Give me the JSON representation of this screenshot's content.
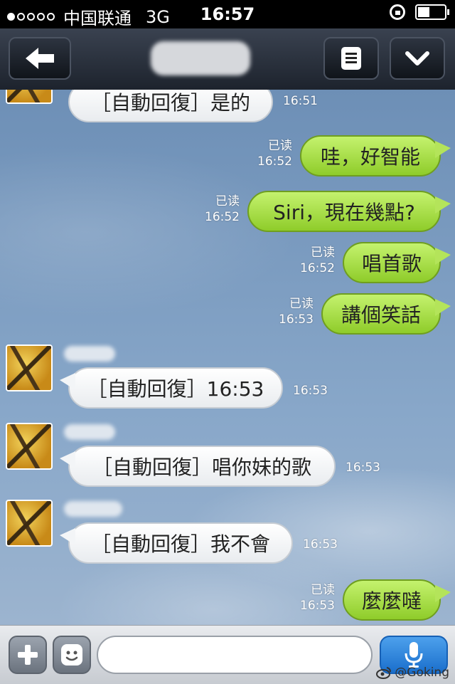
{
  "status_bar": {
    "carrier": "中国联通",
    "network": "3G",
    "time": "16:57",
    "signal_bars_on": 1,
    "signal_bars_total": 5,
    "battery_level": 0.45
  },
  "nav": {
    "back_icon": "arrow-left-icon",
    "menu_icon": "list-icon",
    "dropdown_icon": "chevron-down-icon"
  },
  "messages": [
    {
      "dir": "in",
      "text": "［自動回復］是的",
      "time": "16:51"
    },
    {
      "dir": "out",
      "text": "哇，好智能",
      "read": "已读",
      "time": "16:52"
    },
    {
      "dir": "out",
      "text": "Siri，現在幾點?",
      "read": "已读",
      "time": "16:52"
    },
    {
      "dir": "out",
      "text": "唱首歌",
      "read": "已读",
      "time": "16:52"
    },
    {
      "dir": "out",
      "text": "講個笑話",
      "read": "已读",
      "time": "16:53"
    },
    {
      "dir": "in",
      "text": "［自動回復］16:53",
      "time": "16:53"
    },
    {
      "dir": "in",
      "text": "［自動回復］唱你妹的歌",
      "time": "16:53"
    },
    {
      "dir": "in",
      "text": "［自動回復］我不會",
      "time": "16:53"
    },
    {
      "dir": "out",
      "text": "麼麼噠",
      "read": "已读",
      "time": "16:53"
    }
  ],
  "input": {
    "placeholder": "",
    "value": ""
  },
  "watermark": "@Goking",
  "colors": {
    "incoming_bubble": "#ffffff",
    "outgoing_bubble": "#a6dc46",
    "nav_bg": "#2a313c",
    "chat_bg": "#7c9cc0"
  }
}
